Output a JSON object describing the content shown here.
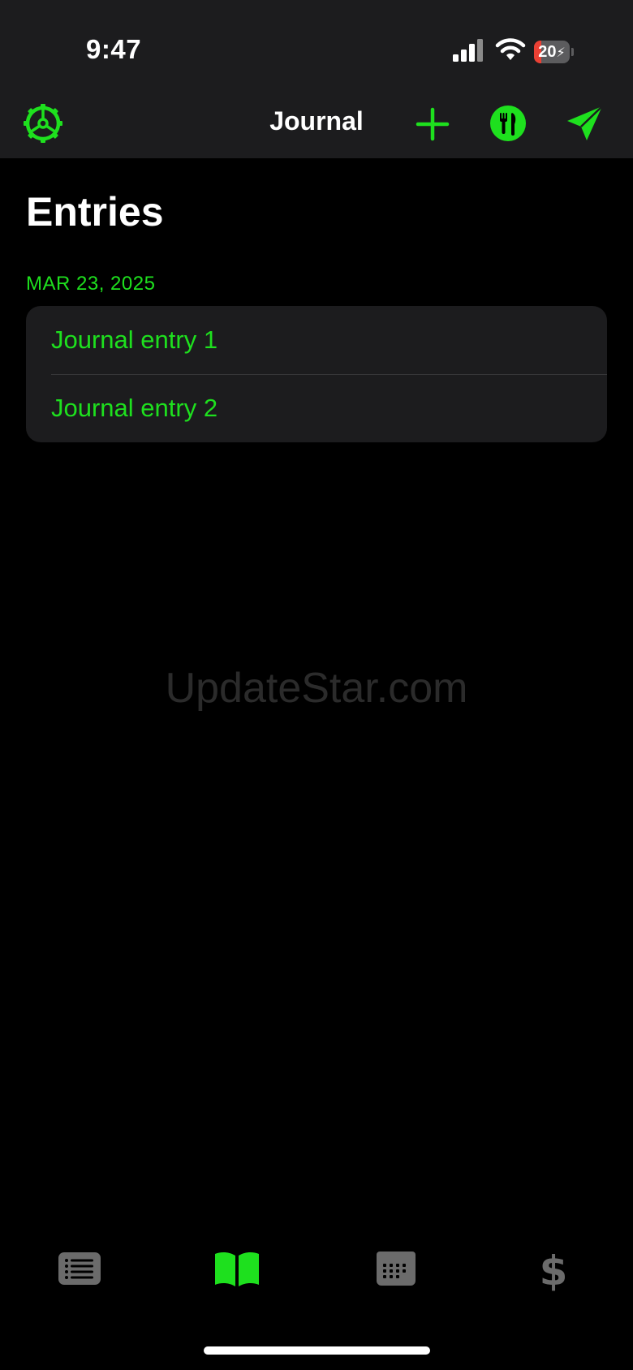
{
  "status_bar": {
    "time": "9:47",
    "battery_text": "20",
    "battery_level_percent": 20
  },
  "nav": {
    "title": "Journal",
    "icons": {
      "left": "gear-icon",
      "right": [
        "plus-icon",
        "fork-knife-icon",
        "paper-plane-icon"
      ]
    }
  },
  "page": {
    "title": "Entries"
  },
  "sections": [
    {
      "header": "MAR 23, 2025",
      "entries": [
        {
          "title": "Journal entry 1"
        },
        {
          "title": "Journal entry 2"
        }
      ]
    }
  ],
  "watermark": "UpdateStar.com",
  "tabs": [
    {
      "icon": "list-icon",
      "active": false
    },
    {
      "icon": "book-icon",
      "active": true
    },
    {
      "icon": "calendar-icon",
      "active": false
    },
    {
      "icon": "dollar-icon",
      "active": false
    }
  ],
  "colors": {
    "accent": "#1ee01e",
    "nav_background": "#1c1c1e",
    "background": "#000000",
    "inactive_tab": "#6b6b6b"
  }
}
